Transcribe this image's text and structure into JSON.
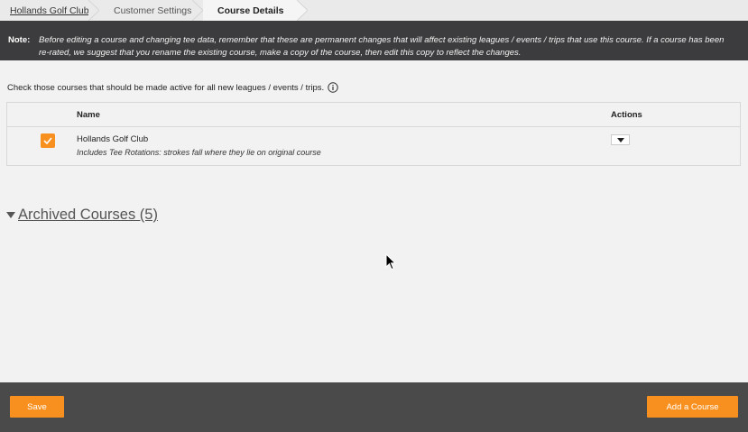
{
  "breadcrumb": {
    "items": [
      {
        "label": "Hollands Golf Club"
      },
      {
        "label": "Customer Settings"
      },
      {
        "label": "Course Details"
      }
    ]
  },
  "note": {
    "label": "Note:",
    "text": "Before editing a course and changing tee data, remember that these are permanent changes that will affect existing leagues / events / trips that use this course. If a course has been re-rated, we suggest that you rename the existing course, make a copy of the course, then edit this copy to reflect the changes."
  },
  "intro": {
    "text": "Check those courses that should be made active for all new leagues / events / trips."
  },
  "table": {
    "headers": {
      "name": "Name",
      "actions": "Actions"
    },
    "rows": [
      {
        "checked": true,
        "name": "Hollands Golf Club",
        "subtitle": "Includes Tee Rotations: strokes fall where they lie on original course"
      }
    ]
  },
  "archived": {
    "label": "Archived Courses (5)"
  },
  "footer": {
    "save_label": "Save",
    "add_label": "Add a Course"
  },
  "colors": {
    "accent": "#f7901e",
    "notebar": "#3c3c3e",
    "footer": "#4a4a4a",
    "background": "#f2f2f2"
  },
  "icons": {
    "info": "info-icon",
    "check": "check-icon",
    "dropdown": "caret-down-icon",
    "archived_toggle": "triangle-down-icon"
  }
}
